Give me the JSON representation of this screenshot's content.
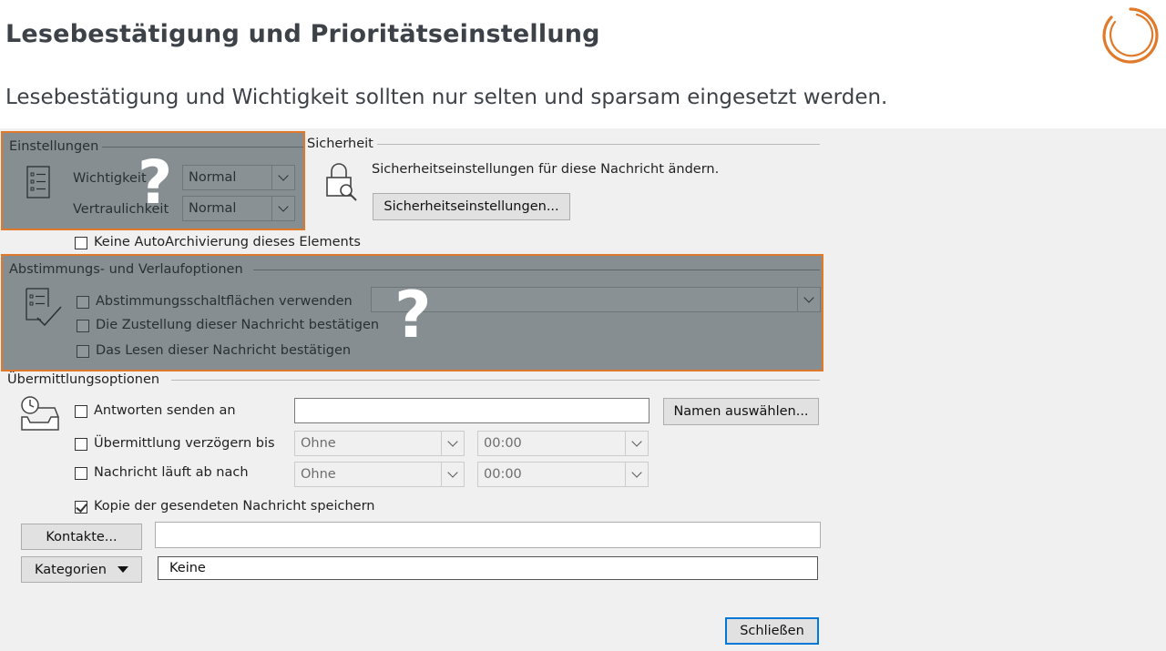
{
  "slide": {
    "title": "Lesebestätigung und Prioritätseinstellung",
    "subtitle": "Lesebestätigung und Wichtigkeit sollten nur selten und sparsam eingesetzt werden.",
    "brand_color": "#e07a2a"
  },
  "dialog": {
    "settings": {
      "label": "Einstellungen",
      "importance_label": "Wichtigkeit",
      "importance_value": "Normal",
      "sensitivity_label": "Vertraulichkeit",
      "sensitivity_value": "Normal",
      "overlay_mark": "?"
    },
    "security": {
      "label": "Sicherheit",
      "description": "Sicherheitseinstellungen für diese Nachricht ändern.",
      "button": "Sicherheitseinstellungen..."
    },
    "no_autoarchive": {
      "label": "Keine AutoArchivierung dieses Elements",
      "checked": false
    },
    "voting": {
      "label": "Abstimmungs- und Verlaufoptionen",
      "use_voting_buttons": "Abstimmungsschaltflächen verwenden",
      "request_delivery_receipt": "Die Zustellung dieser Nachricht bestätigen",
      "request_read_receipt": "Das Lesen dieser Nachricht bestätigen",
      "overlay_mark": "?"
    },
    "delivery": {
      "label": "Übermittlungsoptionen",
      "replies_to_label": "Antworten senden an",
      "replies_to_value": "",
      "select_names_button": "Namen auswählen...",
      "delay_label": "Übermittlung verzögern bis",
      "delay_date": "Ohne",
      "delay_time": "00:00",
      "expires_label": "Nachricht läuft ab nach",
      "expires_date": "Ohne",
      "expires_time": "00:00",
      "save_copy_label": "Kopie der gesendeten Nachricht speichern",
      "save_copy_checked": true
    },
    "contacts": {
      "button": "Kontakte...",
      "value": ""
    },
    "categories": {
      "button": "Kategorien",
      "value": "Keine"
    },
    "close_button": "Schließen"
  }
}
